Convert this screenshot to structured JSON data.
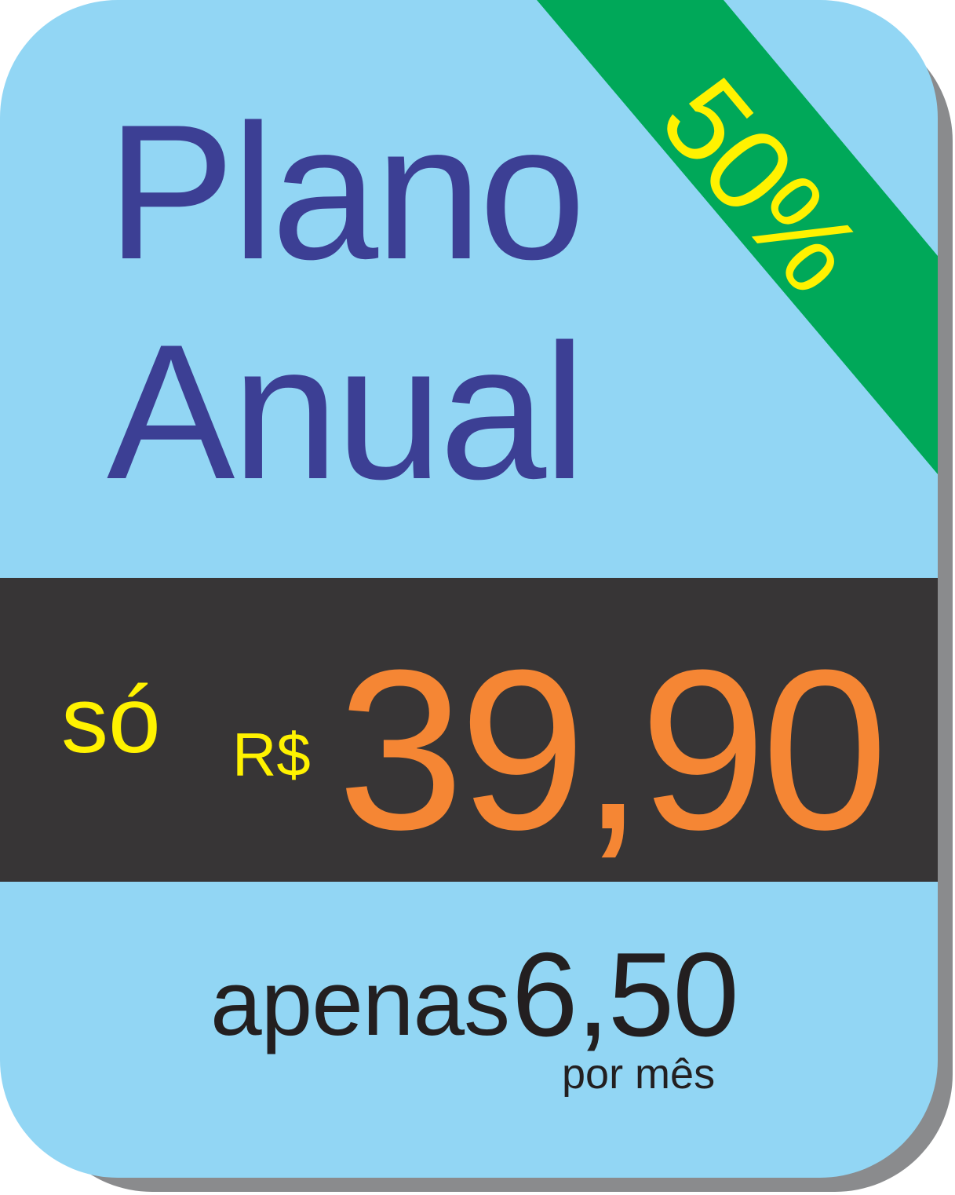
{
  "colors": {
    "card_background": "#92d6f4",
    "card_shadow": "#8a8b8d",
    "ribbon": "#00a859",
    "ribbon_text": "#fff200",
    "title": "#3c3f94",
    "price_band": "#373536",
    "price_value": "#f58634",
    "accent_text": "#fff200",
    "footer_text": "#231f20"
  },
  "ribbon": {
    "label": "50%"
  },
  "title": {
    "line1": "Plano",
    "line2": "Anual"
  },
  "price": {
    "prefix": "só",
    "currency": "R$",
    "value": "39,90"
  },
  "monthly": {
    "prefix": "apenas",
    "value": "6,50",
    "unit": "por mês"
  }
}
